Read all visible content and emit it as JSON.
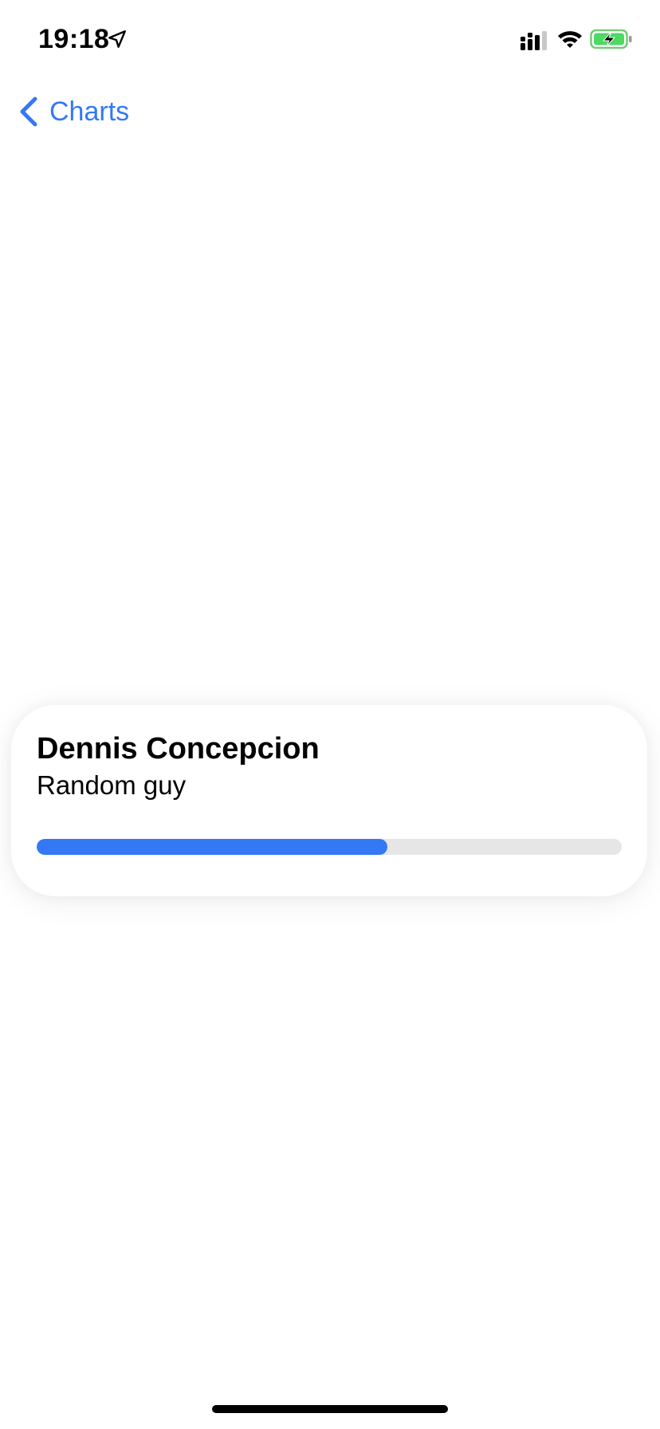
{
  "status_bar": {
    "time": "19:18",
    "icons": [
      "location-arrow-icon",
      "cellular-signal-icon",
      "wifi-icon",
      "battery-charging-icon"
    ],
    "battery_color": "#4cd964"
  },
  "nav": {
    "back_label": "Charts",
    "back_icon": "chevron-left-icon",
    "accent": "#3478f6"
  },
  "card": {
    "title": "Dennis Concepcion",
    "subtitle": "Random guy",
    "progress": 0.6,
    "progress_color": "#3478f6",
    "track_color": "#e6e6e6"
  }
}
